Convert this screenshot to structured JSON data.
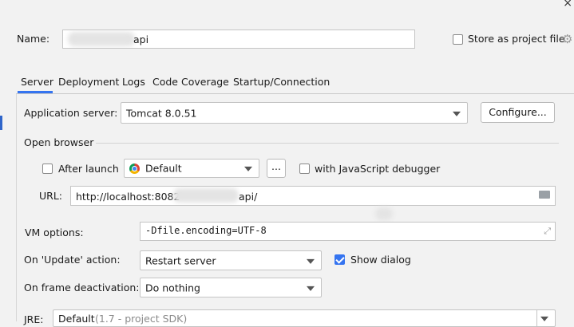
{
  "name": {
    "label": "Name:",
    "value": "api"
  },
  "store_as_project_file": {
    "label": "Store as project file",
    "checked": false
  },
  "tabs": [
    {
      "label": "Server",
      "active": true
    },
    {
      "label": "Deployment",
      "active": false
    },
    {
      "label": "Logs",
      "active": false
    },
    {
      "label": "Code Coverage",
      "active": false
    },
    {
      "label": "Startup/Connection",
      "active": false
    }
  ],
  "server": {
    "application_server": {
      "label": "Application server:",
      "value": "Tomcat 8.0.51"
    },
    "configure_button": "Configure...",
    "open_browser": {
      "title": "Open browser",
      "after_launch": {
        "label": "After launch",
        "checked": false
      },
      "browser": {
        "value": "Default"
      },
      "more_button": "...",
      "js_debugger": {
        "label": "with JavaScript debugger",
        "checked": false
      },
      "url": {
        "label": "URL:",
        "value_prefix": "http://localhost:8082",
        "value_suffix": "api/"
      }
    },
    "vm_options": {
      "label": "VM options:",
      "value": "-Dfile.encoding=UTF-8"
    },
    "on_update": {
      "label": "On 'Update' action:",
      "value": "Restart server"
    },
    "show_dialog": {
      "label": "Show dialog",
      "checked": true
    },
    "on_frame_deactivation": {
      "label": "On frame deactivation:",
      "value": "Do nothing"
    },
    "jre": {
      "label": "JRE:",
      "value": "Default",
      "hint": "(1.7 - project SDK)"
    }
  },
  "colors": {
    "accent": "#3574f0",
    "tab_underline": "#3574f0"
  }
}
